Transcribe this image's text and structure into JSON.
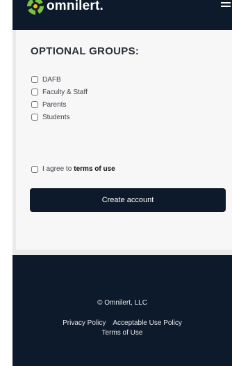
{
  "header": {
    "brand": "omnilert.",
    "menu_icon": "hamburger-menu-icon"
  },
  "groups": {
    "title": "OPTIONAL GROUPS:",
    "items": [
      {
        "label": "DAFB"
      },
      {
        "label": "Faculty & Staff"
      },
      {
        "label": "Parents"
      },
      {
        "label": "Students"
      }
    ]
  },
  "agreement": {
    "prefix": "I agree to",
    "link": "terms of use"
  },
  "actions": {
    "create_label": "Create account"
  },
  "footer": {
    "copyright": "© Omnilert, LLC",
    "privacy": "Privacy Policy",
    "acceptable_use": "Acceptable Use Policy",
    "terms": "Terms of Use"
  },
  "colors": {
    "brand_dark": "#0d1a2b",
    "logo_green": "#7ac143",
    "logo_yellow": "#f2c200"
  }
}
